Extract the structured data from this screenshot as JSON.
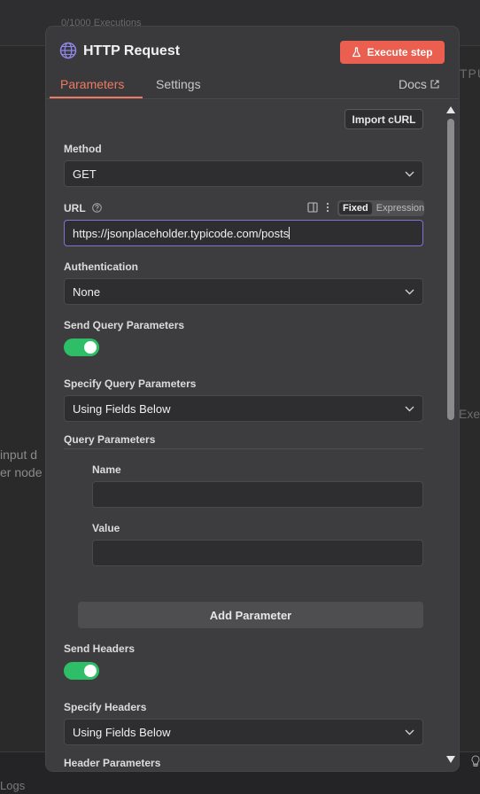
{
  "background": {
    "executions_text": "0/1000 Executions",
    "left_hint": [
      "input d",
      "er node"
    ],
    "right_output": "TPU",
    "right_exec": "Exec",
    "logs": "Logs"
  },
  "panel": {
    "icon": "globe-icon",
    "title": "HTTP Request",
    "execute_label": "Execute step",
    "execute_color": "#ea5f4f"
  },
  "tabs": [
    {
      "label": "Parameters",
      "active": true
    },
    {
      "label": "Settings",
      "active": false
    }
  ],
  "docs_label": "Docs",
  "import_curl_label": "Import cURL",
  "method": {
    "label": "Method",
    "value": "GET"
  },
  "url": {
    "label": "URL",
    "mode_fixed": "Fixed",
    "mode_expression": "Expression",
    "value": "https://jsonplaceholder.typicode.com/posts"
  },
  "authentication": {
    "label": "Authentication",
    "value": "None"
  },
  "send_query": {
    "label": "Send Query Parameters",
    "on": true
  },
  "specify_query": {
    "label": "Specify Query Parameters",
    "value": "Using Fields Below"
  },
  "query_params": {
    "title": "Query Parameters",
    "name_label": "Name",
    "name_value": "",
    "value_label": "Value",
    "value_value": "",
    "add_label": "Add Parameter"
  },
  "send_headers": {
    "label": "Send Headers",
    "on": true
  },
  "specify_headers": {
    "label": "Specify Headers",
    "value": "Using Fields Below"
  },
  "header_params": {
    "title": "Header Parameters"
  },
  "colors": {
    "accent": "#ef7a63",
    "toggle_on": "#2fbe68",
    "focus": "#7c74d6"
  }
}
